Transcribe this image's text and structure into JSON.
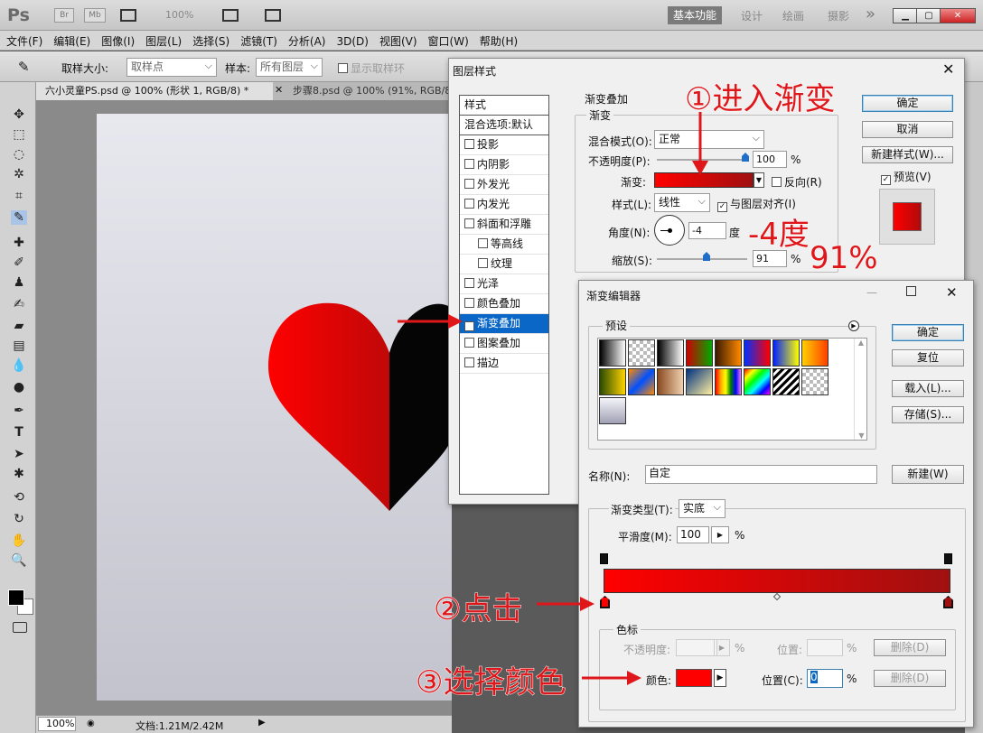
{
  "app": {
    "logo": "Ps",
    "br": "Br",
    "mb": "Mb",
    "zoom": "100%",
    "workspaces": [
      "基本功能",
      "设计",
      "绘画",
      "摄影"
    ],
    "more": "»"
  },
  "menu": [
    "文件(F)",
    "编辑(E)",
    "图像(I)",
    "图层(L)",
    "选择(S)",
    "滤镜(T)",
    "分析(A)",
    "3D(D)",
    "视图(V)",
    "窗口(W)",
    "帮助(H)"
  ],
  "options": {
    "sample_size_label": "取样大小:",
    "sample_size_value": "取样点",
    "sample_label": "样本:",
    "sample_value": "所有图层",
    "show_ring": "显示取样环"
  },
  "tabs": [
    "六小灵童PS.psd @ 100% (形状 1, RGB/8) *",
    "步骤8.psd @ 100% (91%, RGB/8)"
  ],
  "status": {
    "zoom": "100%",
    "doc": "文档:1.21M/2.42M"
  },
  "layer_style": {
    "title": "图层样式",
    "styles_header": "样式",
    "blend_default": "混合选项:默认",
    "items": [
      {
        "label": "投影",
        "checked": false,
        "indent": false
      },
      {
        "label": "内阴影",
        "checked": false,
        "indent": false
      },
      {
        "label": "外发光",
        "checked": false,
        "indent": false
      },
      {
        "label": "内发光",
        "checked": false,
        "indent": false
      },
      {
        "label": "斜面和浮雕",
        "checked": false,
        "indent": false
      },
      {
        "label": "等高线",
        "checked": false,
        "indent": true
      },
      {
        "label": "纹理",
        "checked": false,
        "indent": true
      },
      {
        "label": "光泽",
        "checked": false,
        "indent": false
      },
      {
        "label": "颜色叠加",
        "checked": false,
        "indent": false
      },
      {
        "label": "渐变叠加",
        "checked": true,
        "indent": false,
        "active": true
      },
      {
        "label": "图案叠加",
        "checked": false,
        "indent": false
      },
      {
        "label": "描边",
        "checked": false,
        "indent": false
      }
    ],
    "section_title": "渐变叠加",
    "group_title": "渐变",
    "blend_mode_label": "混合模式(O):",
    "blend_mode_value": "正常",
    "opacity_label": "不透明度(P):",
    "opacity_value": "100",
    "opacity_unit": "%",
    "gradient_label": "渐变:",
    "reverse_label": "反向(R)",
    "style_label": "样式(L):",
    "style_value": "线性",
    "align_label": "与图层对齐(I)",
    "angle_label": "角度(N):",
    "angle_value": "-4",
    "angle_unit": "度",
    "scale_label": "缩放(S):",
    "scale_value": "91",
    "scale_unit": "%",
    "ok": "确定",
    "cancel": "取消",
    "new_style": "新建样式(W)...",
    "preview": "预览(V)"
  },
  "gradient_editor": {
    "title": "渐变编辑器",
    "presets_label": "预设",
    "name_label": "名称(N):",
    "name_value": "自定",
    "new_button": "新建(W)",
    "type_label": "渐变类型(T):",
    "type_value": "实底",
    "smooth_label": "平滑度(M):",
    "smooth_value": "100",
    "smooth_unit": "%",
    "stops_group": "色标",
    "stop_opacity_label": "不透明度:",
    "stop_opacity_unit": "%",
    "stop_pos_label": "位置:",
    "stop_pos_unit": "%",
    "delete1": "删除(D)",
    "color_label": "颜色:",
    "pos_label": "位置(C):",
    "pos_value": "0",
    "pos_unit": "%",
    "delete2": "删除(D)",
    "ok": "确定",
    "reset": "复位",
    "load": "载入(L)...",
    "save": "存储(S)..."
  },
  "annotations": {
    "a1": "①进入渐变",
    "a2": "-4度",
    "a3": "91%",
    "a4": "②点击",
    "a5": "③选择颜色"
  },
  "colors": {
    "gradient_start": "#ff0000",
    "gradient_end": "#a01010",
    "heart_black": "#050505",
    "accent": "#0a67c8"
  }
}
